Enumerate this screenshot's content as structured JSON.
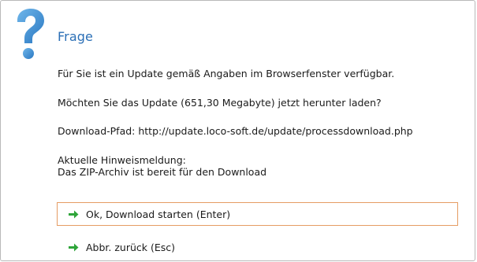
{
  "dialog": {
    "title": "Frage",
    "icon": "question-icon",
    "accent_color": "#2b6fb6",
    "messages": {
      "line1": "Für Sie ist ein Update gemäß Angaben im Browserfenster verfügbar.",
      "line2": "Möchten Sie das Update (651,30 Megabyte) jetzt herunter laden?",
      "line3": "Download-Pfad: http://update.loco-soft.de/update/processdownload.php",
      "hint_label": "Aktuelle Hinweismeldung:",
      "hint_text": "Das ZIP-Archiv ist bereit für den Download"
    },
    "commands": {
      "ok_label": "Ok, Download starten (Enter)",
      "cancel_label": "Abbr. zurück (Esc)",
      "arrow_icon": "arrow-right-icon",
      "arrow_color": "#2fa53a",
      "focus_border_color": "#e59c63"
    }
  }
}
